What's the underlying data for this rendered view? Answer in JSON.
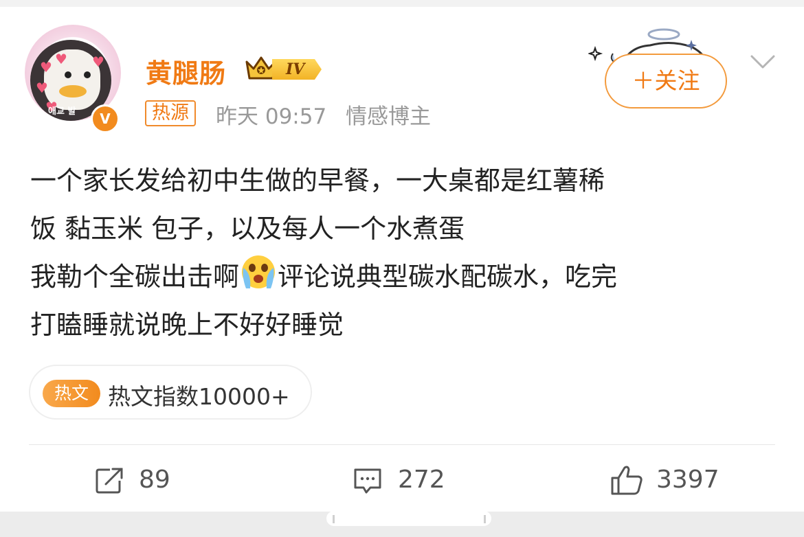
{
  "user": {
    "name": "黄腿肠",
    "level": "IV",
    "avatar_caption": "애교 발",
    "verified_mark": "V"
  },
  "post_meta": {
    "tag": "热源",
    "time": "昨天 09:57",
    "category": "情感博主"
  },
  "follow_button": {
    "label": "＋关注"
  },
  "content": {
    "line1": "一个家长发给初中生做的早餐，一大桌都是红薯稀",
    "line2": "饭 黏玉米 包子，以及每人一个水煮蛋",
    "line3_before_emoji": "我勒个全碳出击啊",
    "emoji": "crying-face",
    "line3_after_emoji": "评论说典型碳水配碳水，吃完",
    "line4": "打瞌睡就说晚上不好好睡觉"
  },
  "hot_index": {
    "badge": "热文",
    "text": "热文指数10000+"
  },
  "actions": {
    "repost_count": "89",
    "comment_count": "272",
    "like_count": "3397"
  },
  "colors": {
    "accent": "#f07a14",
    "text": "#222222",
    "muted": "#999999"
  }
}
